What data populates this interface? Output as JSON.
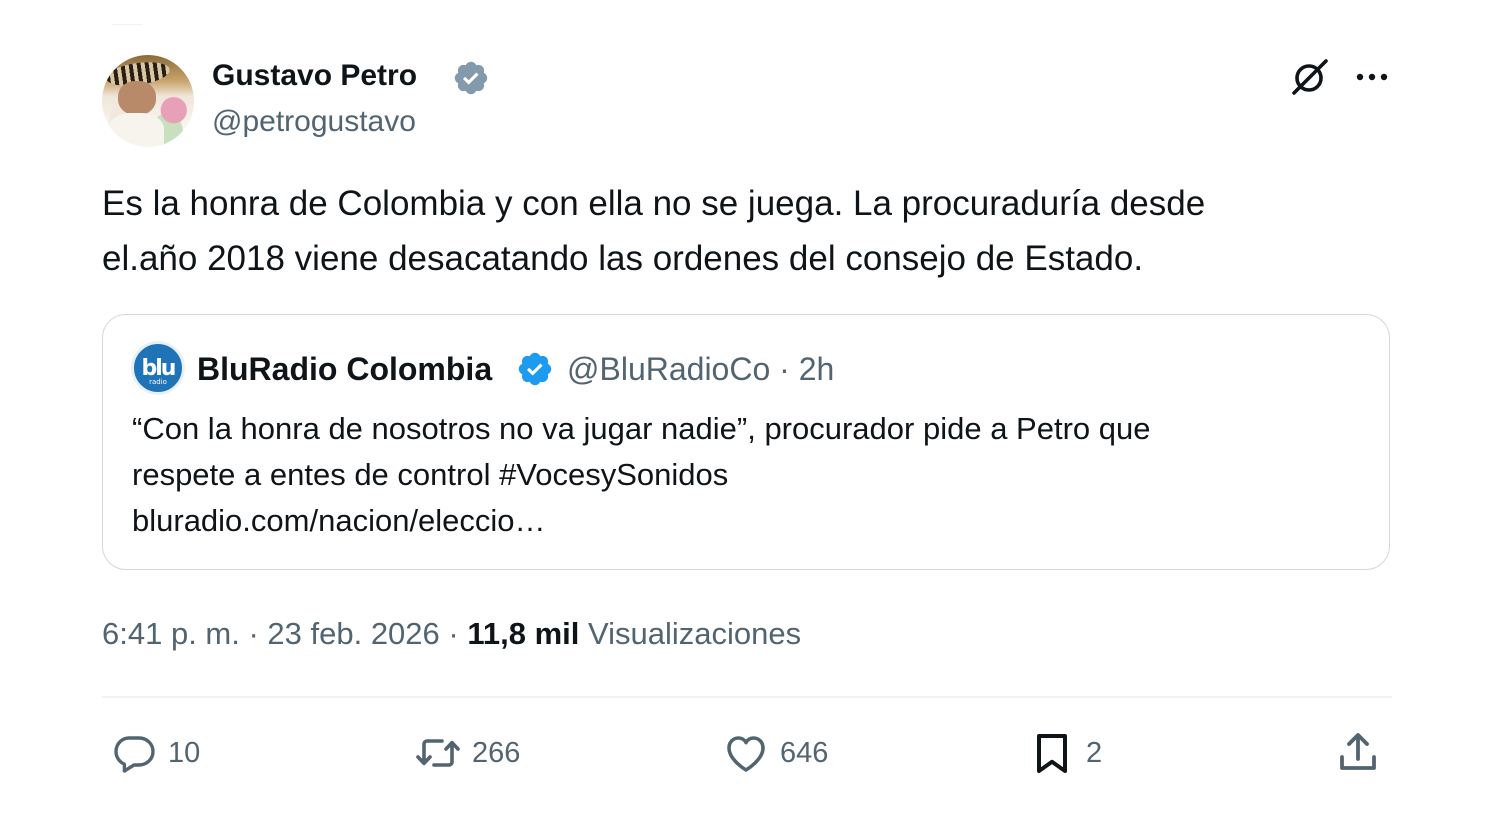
{
  "tweet": {
    "author": {
      "name": "Gustavo Petro",
      "handle": "@petrogustavo",
      "verified": "gray-verified-badge"
    },
    "text_lines": [
      "Es la honra de Colombia y con ella no se juega. La procuraduría desde",
      "el.año 2018 viene desacatando las ordenes del consejo de Estado."
    ],
    "quote": {
      "avatar_text": "blu",
      "avatar_subtext": "radio",
      "name": "BluRadio Colombia",
      "handle_time": "@BluRadioCo · 2h",
      "text_lines": [
        "“Con la honra de nosotros no va jugar nadie”, procurador pide a Petro que",
        "respete a entes de control #VocesySonidos",
        "bluradio.com/nacion/eleccio…"
      ]
    },
    "timestamp": "6:41 p. m. · 23 feb. 2026 · ",
    "views_count": "11,8 mil",
    "views_label": "Visualizaciones",
    "actions": {
      "replies": "10",
      "reposts": "266",
      "likes": "646",
      "bookmarks": "2"
    }
  },
  "icons": {
    "header": [
      "grok-icon",
      "more-icon"
    ],
    "actions": [
      "reply-icon",
      "repost-icon",
      "like-icon",
      "bookmark-icon",
      "share-icon"
    ]
  },
  "colors": {
    "text_primary": "#0f1419",
    "text_secondary": "#536471",
    "border": "#cfd9de",
    "divider": "#eff3f4",
    "verified_blue": "#1d9bf0",
    "verified_gray": "#829aab"
  }
}
